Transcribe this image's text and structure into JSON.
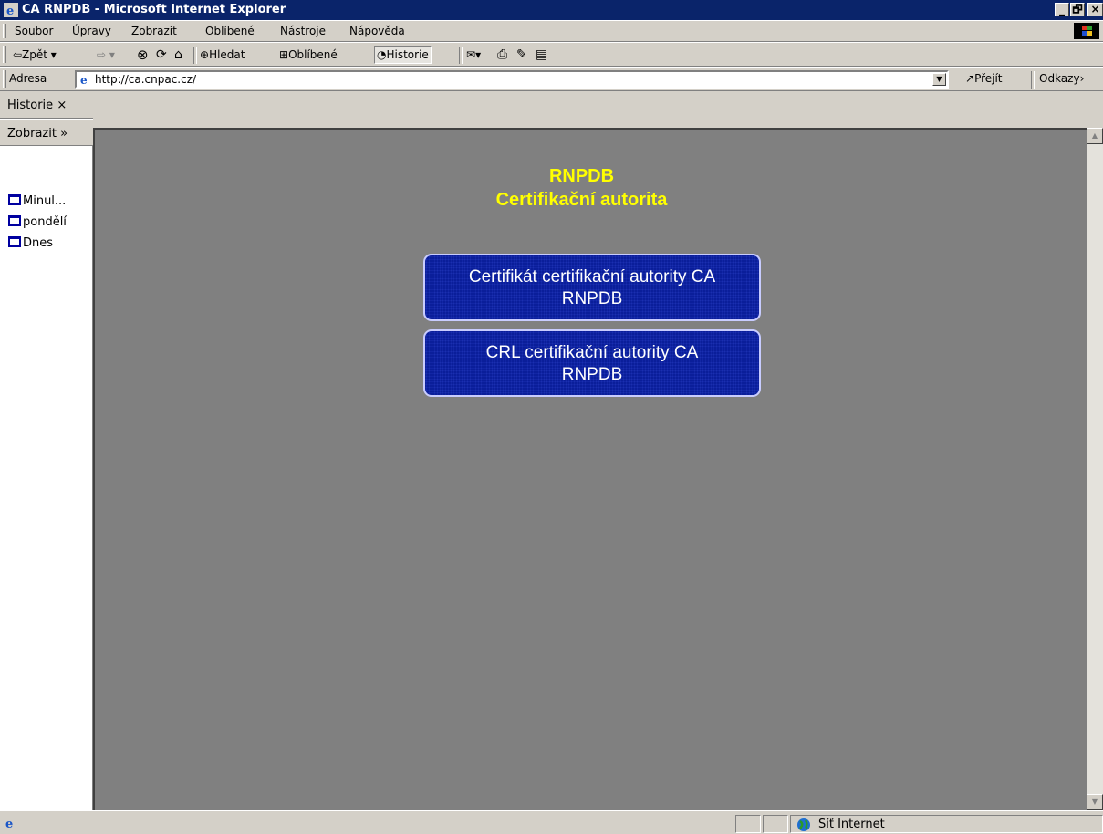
{
  "window": {
    "title": "CA RNPDB - Microsoft Internet Explorer",
    "minimize": "_",
    "maximize": "🗗",
    "close": "×"
  },
  "menu": [
    "Soubor",
    "Úpravy",
    "Zobrazit",
    "Oblíbené",
    "Nástroje",
    "Nápověda"
  ],
  "toolbar": {
    "back": "⇦Zpět ▾",
    "forward": "⇨ ▾",
    "stop": "⊗",
    "refresh": "⟳",
    "home": "⌂",
    "search": "Hledat",
    "favorites": "Oblíbené",
    "history": "Historie",
    "mail": "▾",
    "print": "⎙",
    "edit": "✎",
    "discuss": "▤"
  },
  "address": {
    "label": "Adresa",
    "url": "http://ca.cnpac.cz/",
    "go": "Přejít",
    "links": "Odkazy"
  },
  "sidebar": {
    "title": "Historie",
    "close": "×",
    "view": "Zobrazit",
    "view_more": "»",
    "items": [
      "Minul...",
      "pondělí",
      "Dnes"
    ]
  },
  "page": {
    "title_line1": "RNPDB",
    "title_line2": "Certifikační autorita",
    "buttons": [
      {
        "line1": "Certifikát certifikační autority CA",
        "line2": "RNPDB"
      },
      {
        "line1": "CRL certifikační autority CA",
        "line2": "RNPDB"
      }
    ]
  },
  "status": {
    "zone": "Síť Internet",
    "scroll_up": "▲",
    "scroll_down": "▼"
  }
}
